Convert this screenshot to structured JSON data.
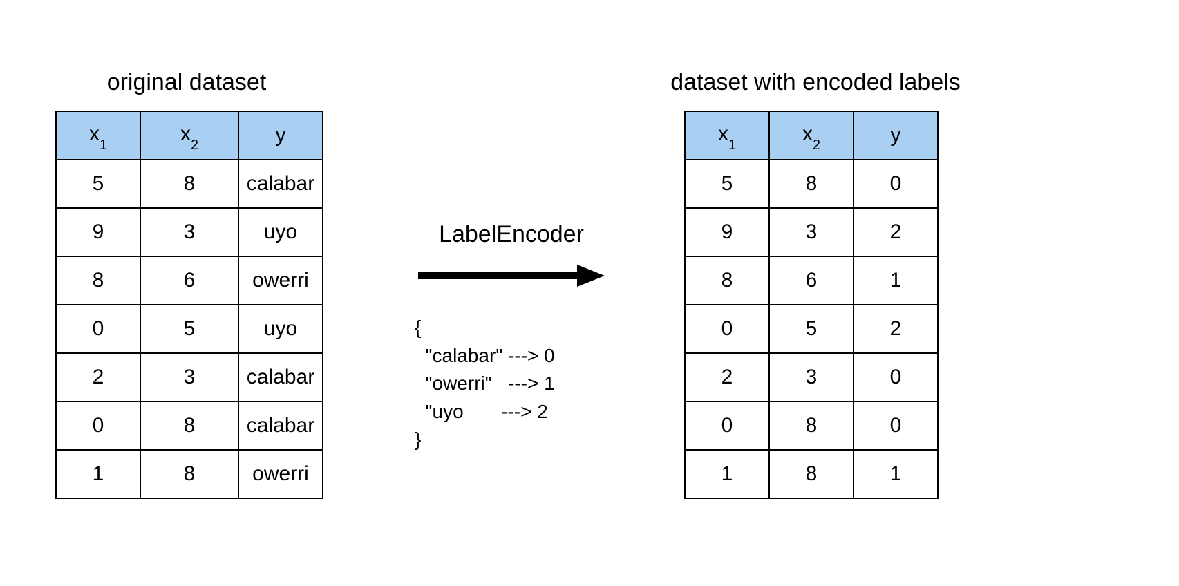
{
  "titles": {
    "left": "original dataset",
    "right": "dataset with encoded labels"
  },
  "columns": {
    "x1_base": "x",
    "x1_sub": "1",
    "x2_base": "x",
    "x2_sub": "2",
    "y": "y"
  },
  "left_table": [
    {
      "x1": "5",
      "x2": "8",
      "y": "calabar"
    },
    {
      "x1": "9",
      "x2": "3",
      "y": "uyo"
    },
    {
      "x1": "8",
      "x2": "6",
      "y": "owerri"
    },
    {
      "x1": "0",
      "x2": "5",
      "y": "uyo"
    },
    {
      "x1": "2",
      "x2": "3",
      "y": "calabar"
    },
    {
      "x1": "0",
      "x2": "8",
      "y": "calabar"
    },
    {
      "x1": "1",
      "x2": "8",
      "y": "owerri"
    }
  ],
  "right_table": [
    {
      "x1": "5",
      "x2": "8",
      "y": "0"
    },
    {
      "x1": "9",
      "x2": "3",
      "y": "2"
    },
    {
      "x1": "8",
      "x2": "6",
      "y": "1"
    },
    {
      "x1": "0",
      "x2": "5",
      "y": "2"
    },
    {
      "x1": "2",
      "x2": "3",
      "y": "0"
    },
    {
      "x1": "0",
      "x2": "8",
      "y": "0"
    },
    {
      "x1": "1",
      "x2": "8",
      "y": "1"
    }
  ],
  "encoder": {
    "label": "LabelEncoder",
    "open": "{",
    "close": "}",
    "lines": [
      "  \"calabar\" ---> 0",
      "  \"owerri\"   ---> 1",
      "  \"uyo       ---> 2"
    ]
  },
  "chart_data": {
    "type": "table",
    "encoder": "LabelEncoder",
    "label_mapping": {
      "calabar": 0,
      "owerri": 1,
      "uyo": 2
    },
    "original": {
      "columns": [
        "x1",
        "x2",
        "y"
      ],
      "rows": [
        [
          5,
          8,
          "calabar"
        ],
        [
          9,
          3,
          "uyo"
        ],
        [
          8,
          6,
          "owerri"
        ],
        [
          0,
          5,
          "uyo"
        ],
        [
          2,
          3,
          "calabar"
        ],
        [
          0,
          8,
          "calabar"
        ],
        [
          1,
          8,
          "owerri"
        ]
      ]
    },
    "encoded": {
      "columns": [
        "x1",
        "x2",
        "y"
      ],
      "rows": [
        [
          5,
          8,
          0
        ],
        [
          9,
          3,
          2
        ],
        [
          8,
          6,
          1
        ],
        [
          0,
          5,
          2
        ],
        [
          2,
          3,
          0
        ],
        [
          0,
          8,
          0
        ],
        [
          1,
          8,
          1
        ]
      ]
    }
  }
}
